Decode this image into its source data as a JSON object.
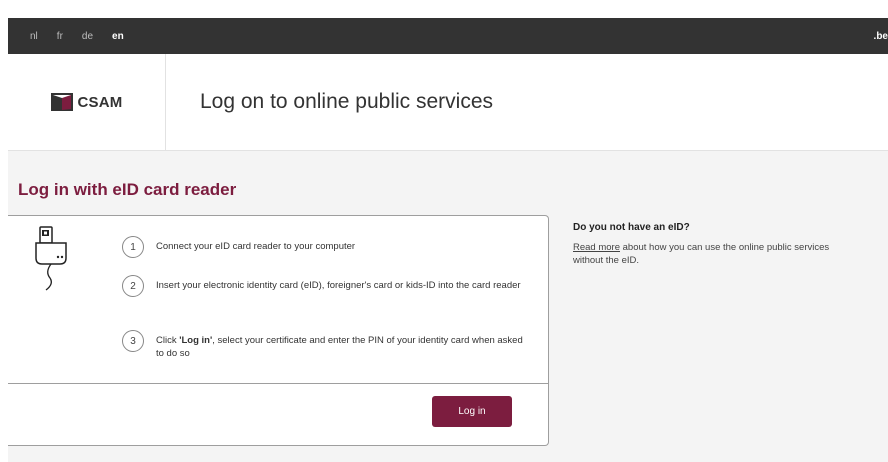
{
  "topbar": {
    "languages": [
      {
        "code": "nl",
        "active": false
      },
      {
        "code": "fr",
        "active": false
      },
      {
        "code": "de",
        "active": false
      },
      {
        "code": "en",
        "active": true
      }
    ],
    "tld": ".be"
  },
  "header": {
    "logo_text": "CSAM",
    "title": "Log on to online public services"
  },
  "main": {
    "section_title": "Log in with eID card reader",
    "steps": [
      {
        "number": "1",
        "text": "Connect your eID card reader to your computer"
      },
      {
        "number": "2",
        "text": "Insert your electronic identity card (eID), foreigner's card or kids-ID into the card reader"
      },
      {
        "number": "3",
        "text_bold": "'Log in'",
        "text_pre": "Click ",
        "text_post": ", select your certificate and enter the PIN of your identity card when asked to do so"
      }
    ],
    "login_label": "Log in"
  },
  "aside": {
    "title": "Do you not have an eID?",
    "link_text": "Read more",
    "text": " about how you can use the online public services without the eID."
  },
  "colors": {
    "accent": "#7c1d3f",
    "topbar": "#333333"
  },
  "icons": [
    "csam-logo-icon",
    "card-reader-icon"
  ]
}
